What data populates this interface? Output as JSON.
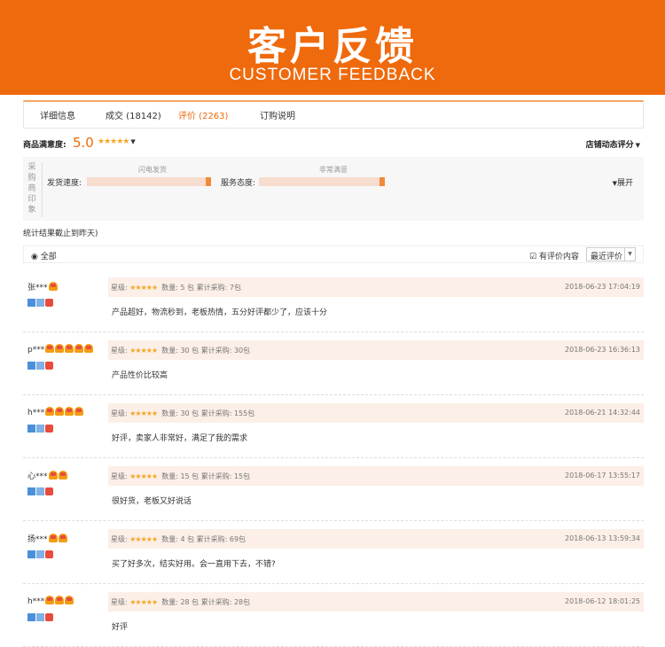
{
  "banner": {
    "title": "客户反馈",
    "subtitle": "CUSTOMER FEEDBACK"
  },
  "tabs": [
    {
      "label": "详细信息"
    },
    {
      "label": "成交 (18142)"
    },
    {
      "label": "评价 (2263)"
    },
    {
      "label": "订购说明"
    }
  ],
  "active_tab": 2,
  "satisfaction": {
    "label": "商品满意度:",
    "score": "5.0",
    "stars": "★★★★★",
    "caret": "▼",
    "shop_score_label": "店铺动态评分"
  },
  "impression": {
    "vertical_label": "采购商印象",
    "metrics": [
      {
        "label": "发货速度:",
        "top_label": "闪电发货"
      },
      {
        "label": "服务态度:",
        "top_label": "非常满意"
      }
    ],
    "expand_label": "展开"
  },
  "stat_note": "统计结果截止到昨天)",
  "filter": {
    "all_label": "全部",
    "has_content_label": "有评价内容",
    "sort_label": "最近评价"
  },
  "reviews": [
    {
      "user": "张***",
      "medals": 1,
      "stars": "★★★★★",
      "meta": "数量: 5 包  累计采购: 7包",
      "time": "2018-06-23 17:04:19",
      "text": "产品超好，物流秒到，老板热情，五分好评都少了，应该十分"
    },
    {
      "user": "p***",
      "medals": 5,
      "stars": "★★★★★",
      "meta": "数量: 30 包  累计采购: 30包",
      "time": "2018-06-23 16:36:13",
      "text": "产品性价比较高"
    },
    {
      "user": "h***",
      "medals": 4,
      "stars": "★★★★★",
      "meta": "数量: 30 包  累计采购: 155包",
      "time": "2018-06-21 14:32:44",
      "text": "好评，卖家人非常好，满足了我的需求"
    },
    {
      "user": "心***",
      "medals": 2,
      "stars": "★★★★★",
      "meta": "数量: 15 包  累计采购: 15包",
      "time": "2018-06-17 13:55:17",
      "text": "很好货，老板又好说话"
    },
    {
      "user": "扬***",
      "medals": 2,
      "stars": "★★★★★",
      "meta": "数量: 4 包  累计采购: 69包",
      "time": "2018-06-13 13:59:34",
      "text": "买了好多次，结实好用。会一直用下去，不错?"
    },
    {
      "user": "h***",
      "medals": 3,
      "stars": "★★★★★",
      "meta": "数量: 28 包  累计采购: 28包",
      "time": "2018-06-12 18:01:25",
      "text": "好评"
    }
  ],
  "labels": {
    "star_level": "星级:"
  },
  "colors": {
    "accent": "#ef6a0c",
    "review_header": "#fcefe7"
  }
}
